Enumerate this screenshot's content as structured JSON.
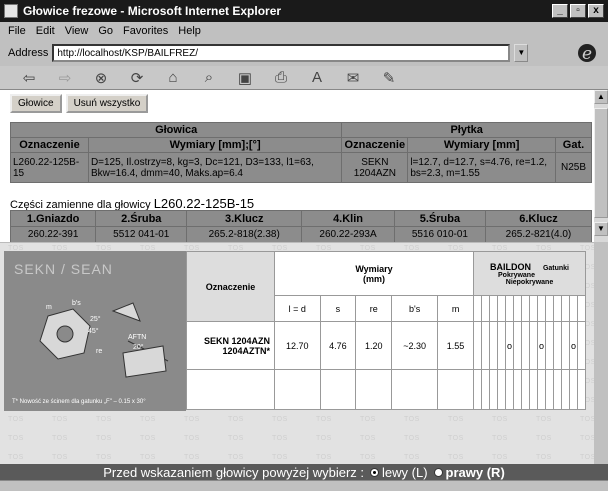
{
  "window": {
    "title": "Głowice frezowe - Microsoft Internet Explorer",
    "min": "_",
    "max": "▫",
    "close": "x"
  },
  "menu": [
    "File",
    "Edit",
    "View",
    "Go",
    "Favorites",
    "Help"
  ],
  "address": {
    "label": "Address",
    "value": "http://localhost/KSP/BAILFREZ/"
  },
  "toolbar_icons": [
    "back-icon",
    "forward-icon",
    "stop-icon",
    "refresh-icon",
    "home-icon",
    "search-icon",
    "favorites-icon",
    "print-icon",
    "font-icon",
    "mail-icon",
    "edit-icon"
  ],
  "buttons": {
    "glowice": "Głowice",
    "usun": "Usuń wszystko"
  },
  "head": {
    "glowica": "Głowica",
    "plytka": "Płytka",
    "col_oznaczenie": "Oznaczenie",
    "col_wymiary_glowica": "Wymiary [mm];[°]",
    "col_oznaczenie2": "Oznaczenie",
    "col_wymiary_plytka": "Wymiary [mm]",
    "col_gat": "Gat.",
    "row": {
      "oznaczenie": "L260.22-125B-15",
      "wymiary": "D=125, Il.ostrzy=8, kg=3, Dc=121, D3=133, l1=63, Bkw=16.4, dmm=40, Maks.ap=6.4",
      "plytka_ozn": "SEKN 1204AZN",
      "plytka_wym": "l=12.7, d=12.7, s=4.76, re=1.2, bs=2.3, m=1.55",
      "gat": "N25B"
    }
  },
  "czesci": {
    "label": "Części zamienne dla głowicy",
    "code": "L260.22-125B-15"
  },
  "parts": {
    "headers": [
      "1.Gniazdo",
      "2.Śruba",
      "3.Klucz",
      "4.Klin",
      "5.Śruba",
      "6.Klucz"
    ],
    "values": [
      "260.22-391",
      "5512 041-01",
      "265.2-818(2.38)",
      "260.22-293A",
      "5516 010-01",
      "265.2-821(4.0)"
    ]
  },
  "catalog": {
    "title": "SEKN / SEAN",
    "oznaczenie": "Oznaczenie",
    "wymiary": "Wymiary",
    "unit": "(mm)",
    "dims": [
      "l = d",
      "s",
      "re",
      "b's",
      "m"
    ],
    "brand": "BAILDON",
    "gatunki": "Gatunki",
    "pokrywane": "Pokrywane",
    "niepokrywane": "Niepokrywane",
    "insert1": "SEKN 1204AZN",
    "insert2": "1204AZTN*",
    "values": [
      "12.70",
      "4.76",
      "1.20",
      "~2.30",
      "1.55"
    ],
    "note": "T* Nowość ze ścinem dla gatunku „F\" – 0.15 x 30°",
    "angles": [
      "25°",
      "45°",
      "AFTN",
      "20°",
      "re",
      "m",
      "b's"
    ]
  },
  "radio": {
    "prompt": "Przed wskazaniem głowicy powyżej wybierz :",
    "left": "lewy (L)",
    "right": "prawy (R)"
  },
  "watermark": "TOS"
}
